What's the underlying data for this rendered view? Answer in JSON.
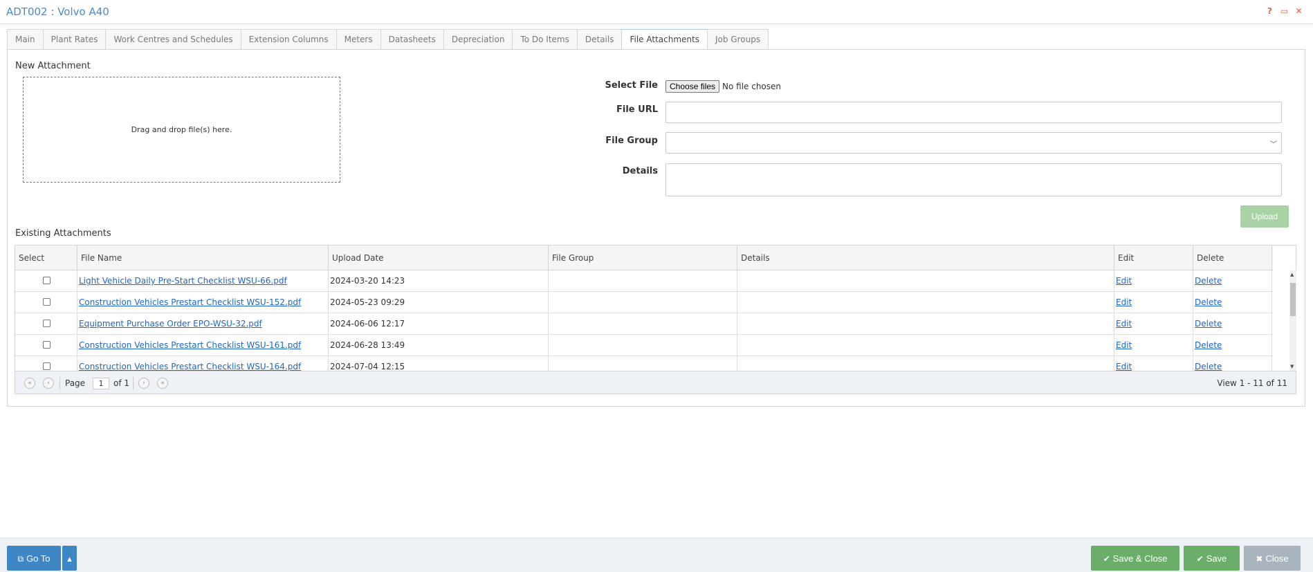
{
  "window": {
    "title": "ADT002 : Volvo A40",
    "icons": [
      "help-icon",
      "window-icon",
      "close-icon"
    ]
  },
  "tabs": [
    {
      "label": "Main"
    },
    {
      "label": "Plant Rates"
    },
    {
      "label": "Work Centres and Schedules"
    },
    {
      "label": "Extension Columns"
    },
    {
      "label": "Meters"
    },
    {
      "label": "Datasheets"
    },
    {
      "label": "Depreciation"
    },
    {
      "label": "To Do Items"
    },
    {
      "label": "Details"
    },
    {
      "label": "File Attachments",
      "active": true
    },
    {
      "label": "Job Groups"
    }
  ],
  "new_attachment": {
    "heading": "New Attachment",
    "dropzone_text": "Drag and drop file(s) here.",
    "select_file_label": "Select File",
    "choose_button": "Choose files",
    "no_file_text": "No file chosen",
    "file_url_label": "File URL",
    "file_url_value": "",
    "file_group_label": "File Group",
    "file_group_value": "",
    "details_label": "Details",
    "details_value": "",
    "upload_button": "Upload"
  },
  "existing": {
    "heading": "Existing Attachments",
    "columns": [
      "Select",
      "File Name",
      "Upload Date",
      "File Group",
      "Details",
      "Edit",
      "Delete"
    ],
    "rows": [
      {
        "file_name": "Light Vehicle Daily Pre-Start Checklist WSU-66.pdf",
        "upload_date": "2024-03-20 14:23",
        "file_group": "",
        "details": "",
        "edit": "Edit",
        "delete": "Delete"
      },
      {
        "file_name": "Construction Vehicles Prestart Checklist WSU-152.pdf",
        "upload_date": "2024-05-23 09:29",
        "file_group": "",
        "details": "",
        "edit": "Edit",
        "delete": "Delete"
      },
      {
        "file_name": "Equipment Purchase Order EPO-WSU-32.pdf",
        "upload_date": "2024-06-06 12:17",
        "file_group": "",
        "details": "",
        "edit": "Edit",
        "delete": "Delete"
      },
      {
        "file_name": "Construction Vehicles Prestart Checklist WSU-161.pdf",
        "upload_date": "2024-06-28 13:49",
        "file_group": "",
        "details": "",
        "edit": "Edit",
        "delete": "Delete"
      },
      {
        "file_name": "Construction Vehicles Prestart Checklist WSU-164.pdf",
        "upload_date": "2024-07-04 12:15",
        "file_group": "",
        "details": "",
        "edit": "Edit",
        "delete": "Delete"
      }
    ],
    "pager": {
      "page_label": "Page",
      "page_value": "1",
      "of_label": "of 1",
      "view_text": "View 1 - 11 of 11"
    }
  },
  "footer": {
    "goto_label": "Go To",
    "save_close_label": "Save & Close",
    "save_label": "Save",
    "close_label": "Close",
    "colors": {
      "primary": "#3e86c6",
      "success": "#6aae6a",
      "muted": "#a9b4bf"
    }
  }
}
